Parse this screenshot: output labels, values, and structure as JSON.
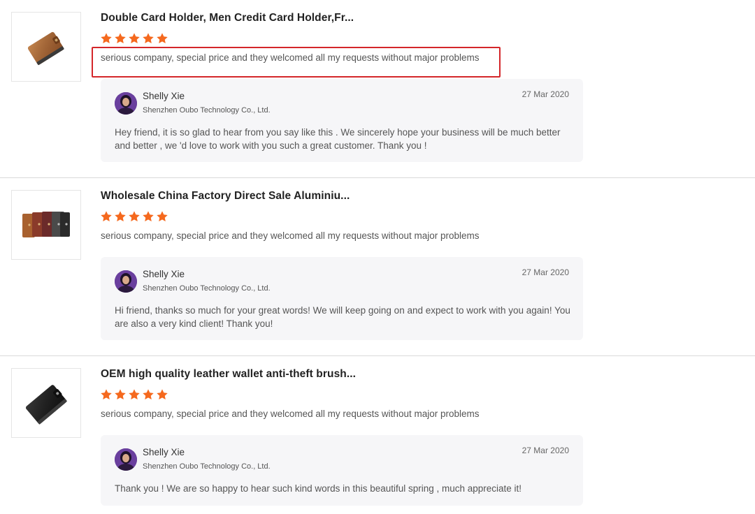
{
  "reviews": [
    {
      "product_title": "Double Card Holder, Men Credit Card Holder,Fr...",
      "rating": 5,
      "rating_max": 5,
      "review_text": "serious company, special price and they welcomed all my requests without major problems",
      "product_image_icon": "brown-leather-card-holder",
      "reply": {
        "name": "Shelly Xie",
        "company": "Shenzhen Oubo Technology Co., Ltd.",
        "date": "27 Mar 2020",
        "text": "Hey friend, it is so glad to hear from you say like this . We sincerely hope your business will be much better and better , we 'd love to work with you such a great customer. Thank you !"
      }
    },
    {
      "product_title": "Wholesale China Factory Direct Sale Aluminiu...",
      "rating": 5,
      "rating_max": 5,
      "review_text": "serious company, special price and they welcomed all my requests without major problems",
      "product_image_icon": "multi-color-wallets",
      "reply": {
        "name": "Shelly Xie",
        "company": "Shenzhen Oubo Technology Co., Ltd.",
        "date": "27 Mar 2020",
        "text": "Hi friend, thanks so much for your great words! We will keep going on and expect to work with you again! You are also a very kind client! Thank you!"
      }
    },
    {
      "product_title": "OEM high quality leather wallet anti-theft brush...",
      "rating": 5,
      "rating_max": 5,
      "review_text": "serious company, special price and they welcomed all my requests without major problems",
      "product_image_icon": "black-leather-wallet",
      "reply": {
        "name": "Shelly Xie",
        "company": "Shenzhen Oubo Technology Co., Ltd.",
        "date": "27 Mar 2020",
        "text": "Thank you ! We are so happy to hear such kind words in this beautiful spring , much appreciate it!"
      }
    }
  ],
  "colors": {
    "star": "#f5691e",
    "highlight": "#d4262a",
    "reply_bg": "#f6f6f8"
  }
}
